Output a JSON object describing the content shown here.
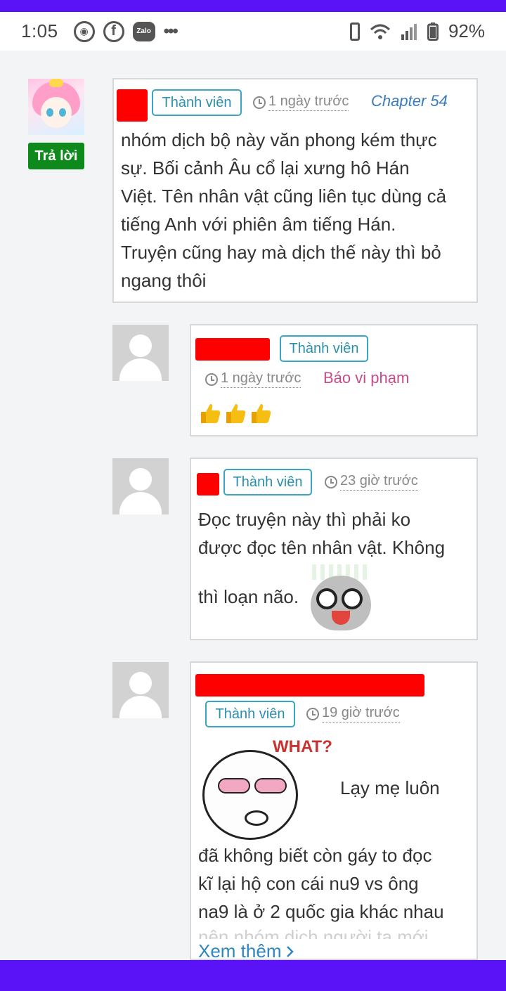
{
  "status_bar": {
    "time": "1:05",
    "app_icons": [
      "chrome-icon",
      "facebook-icon",
      "zalo-icon"
    ],
    "zalo_label": "Zalo",
    "more": "•••",
    "battery_percent": "92%",
    "colors": {
      "band": "#5a12f6"
    }
  },
  "comments": [
    {
      "avatar": "anime-avatar",
      "reply_label": "Trả lời",
      "badge": "Thành viên",
      "time": "1 ngày trước",
      "chapter": "Chapter 54",
      "lines": [
        "nhóm dịch bộ này văn phong kém thực",
        "sự. Bối cảnh Âu cổ lại xưng hô Hán",
        "Việt. Tên nhân vật cũng liên tục dùng cả",
        "tiếng Anh với phiên âm tiếng Hán.",
        "Truyện cũng hay mà dịch thế này thì bỏ",
        "ngang thôi"
      ]
    },
    {
      "badge": "Thành viên",
      "time": "1 ngày trước",
      "report": "Báo vi phạm",
      "reaction": "thumbs-up-x3"
    },
    {
      "badge": "Thành viên",
      "time": "23 giờ trước",
      "lines": [
        "Đọc truyện này thì phải ko",
        "được đọc tên nhân vật. Không",
        "thì loạn não."
      ],
      "sticker": "panda-sticker"
    },
    {
      "badge": "Thành viên",
      "time": "19 giờ trước",
      "sticker_text": "WHAT?",
      "sticker": "what-face-sticker",
      "first_line": "Lạy mẹ luôn",
      "lines": [
        "đã không biết còn gáy to đọc",
        "kĩ lại hộ con cái nu9 vs ông",
        "na9 là ở 2 quốc gia khác nhau"
      ],
      "faded_line": "nên nhóm dịch người ta mới",
      "more_label": "Xem thêm"
    }
  ],
  "colors": {
    "badge_border": "#3aa6c4",
    "report": "#c84a8a",
    "chapter": "#3a7bbf",
    "reply_button": "#0e8a1c",
    "redacted": "#ff0000"
  }
}
